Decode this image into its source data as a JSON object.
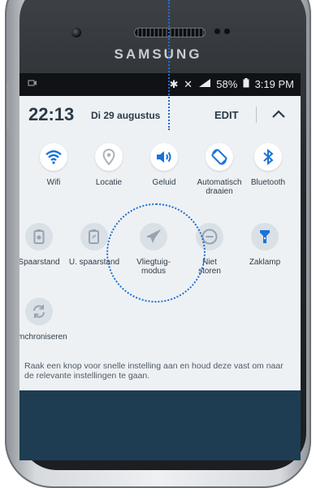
{
  "phone": {
    "brand": "SAMSUNG"
  },
  "status_bar": {
    "left_icon": "notification-icon",
    "battery": "58%",
    "time": "3:19 PM"
  },
  "panel": {
    "clock": "22:13",
    "date": "Di 29 augustus",
    "edit_label": "EDIT",
    "collapse_icon": "chevron-up-icon",
    "tiles": [
      {
        "label": "Wifi",
        "icon": "wifi-icon",
        "active": true
      },
      {
        "label": "Locatie",
        "icon": "location-pin-icon",
        "active": false
      },
      {
        "label": "Geluid",
        "icon": "speaker-icon",
        "active": true
      },
      {
        "label": "Automatisch\ndraaien",
        "icon": "auto-rotate-icon",
        "active": false
      },
      {
        "label": "Bluetooth",
        "icon": "bluetooth-icon",
        "active": false
      },
      {
        "label": "Spaarstand",
        "icon": "power-saving-icon",
        "active": false
      },
      {
        "label": "U. spaarstand",
        "icon": "ultra-power-saving-icon",
        "active": false
      },
      {
        "label": "Vliegtuig-\nmodus",
        "icon": "airplane-icon",
        "active": false
      },
      {
        "label": "Niet\nstoren",
        "icon": "do-not-disturb-icon",
        "active": false
      },
      {
        "label": "Zaklamp",
        "icon": "flashlight-icon",
        "active": false
      },
      {
        "label": "Synchroniseren",
        "icon": "sync-icon",
        "active": false
      }
    ],
    "hint": "Raak een knop voor snelle instelling aan en houd deze vast om naar de relevante instellingen te gaan."
  },
  "colors": {
    "accent_blue": "#1a73d9",
    "icon_inactive": "#a9b4bf",
    "panel_bg": "#eef1f4",
    "annotation": "#1e6fd0"
  }
}
